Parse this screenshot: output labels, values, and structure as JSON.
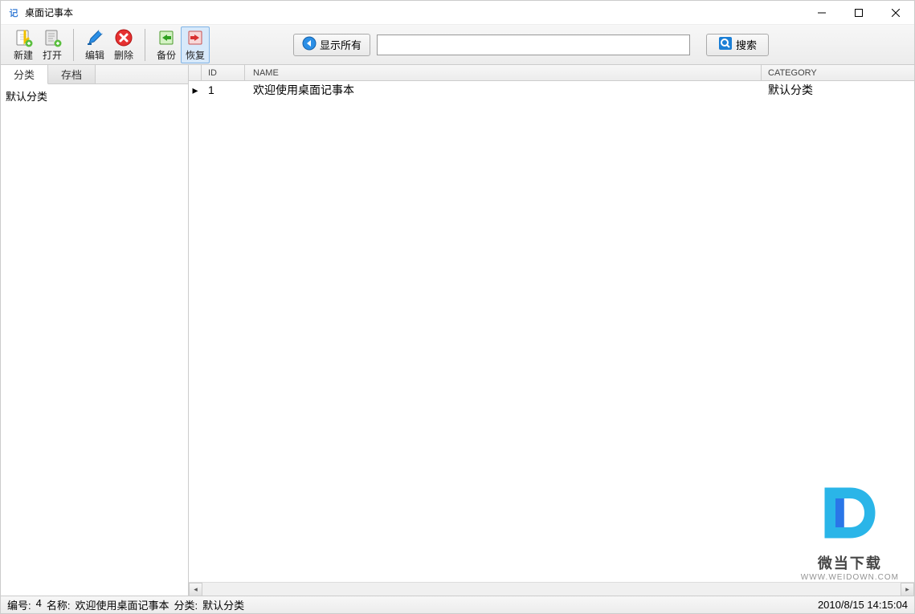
{
  "window": {
    "icon_label": "记",
    "title": "桌面记事本"
  },
  "toolbar": {
    "new": "新建",
    "open": "打开",
    "edit": "编辑",
    "delete": "删除",
    "backup": "备份",
    "restore": "恢复"
  },
  "actions": {
    "show_all": "显示所有",
    "search": "搜索",
    "search_placeholder": ""
  },
  "left": {
    "tab_category": "分类",
    "tab_archive": "存档",
    "tree": {
      "default_category": "默认分类"
    }
  },
  "grid": {
    "headers": {
      "id": "ID",
      "name": "NAME",
      "category": "CATEGORY"
    },
    "rows": [
      {
        "id": "1",
        "name": "欢迎使用桌面记事本",
        "category": "默认分类"
      }
    ]
  },
  "status": {
    "id_label": "编号:",
    "id_value": "4",
    "name_label": "名称:",
    "name_value": "欢迎使用桌面记事本",
    "cat_label": "分类:",
    "cat_value": "默认分类",
    "datetime": "2010/8/15 14:15:04"
  },
  "watermark": {
    "text": "微当下载",
    "url": "WWW.WEIDOWN.COM"
  }
}
